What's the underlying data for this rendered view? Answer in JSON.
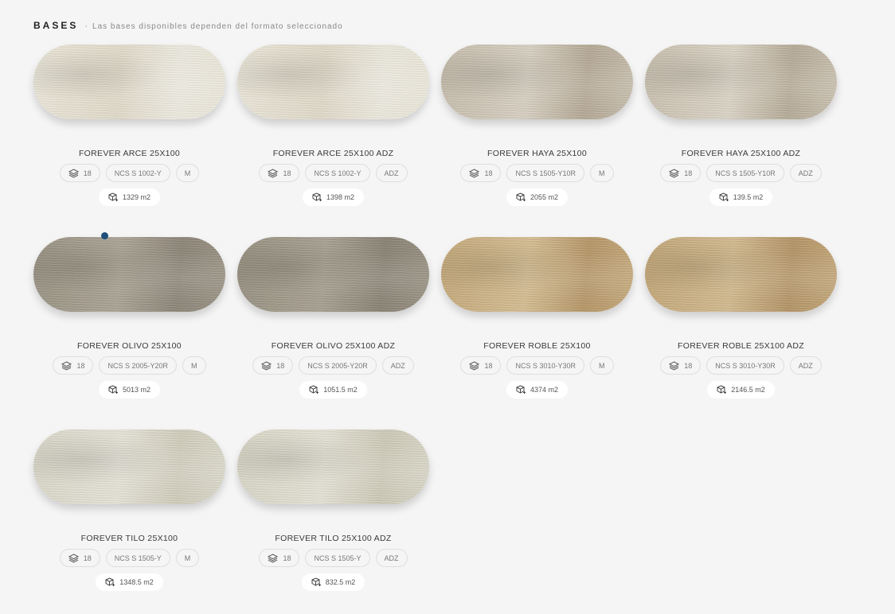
{
  "header": {
    "title": "BASES",
    "separator": "·",
    "subtitle": "Las bases disponibles dependen del formato seleccionado"
  },
  "items": [
    {
      "name": "FOREVER ARCE 25X100",
      "thickness": "18",
      "ncs": "NCS S 1002-Y",
      "finish": "M",
      "stock": "1329 m2",
      "tone": [
        "#ece8da",
        "#e3ddcc",
        "#efece2"
      ]
    },
    {
      "name": "FOREVER ARCE 25X100 ADZ",
      "thickness": "18",
      "ncs": "NCS S 1002-Y",
      "finish": "ADZ",
      "stock": "1398 m2",
      "tone": [
        "#ece8da",
        "#e2dccb",
        "#eeebe0"
      ]
    },
    {
      "name": "FOREVER HAYA 25X100",
      "thickness": "18",
      "ncs": "NCS S 1505-Y10R",
      "finish": "M",
      "stock": "2055 m2",
      "tone": [
        "#c8bfae",
        "#d9d2c4",
        "#b7ab98"
      ]
    },
    {
      "name": "FOREVER HAYA 25X100 ADZ",
      "thickness": "18",
      "ncs": "NCS S 1505-Y10R",
      "finish": "ADZ",
      "stock": "139.5 m2",
      "tone": [
        "#cbc2b1",
        "#ddd6c8",
        "#b8ad9a"
      ]
    },
    {
      "name": "FOREVER OLIVO 25X100",
      "thickness": "18",
      "ncs": "NCS S 2005-Y20R",
      "finish": "M",
      "stock": "5013 m2",
      "tone": [
        "#9c9586",
        "#ada697",
        "#8f877a"
      ]
    },
    {
      "name": "FOREVER OLIVO 25X100 ADZ",
      "thickness": "18",
      "ncs": "NCS S 2005-Y20R",
      "finish": "ADZ",
      "stock": "1051.5 m2",
      "tone": [
        "#9a9384",
        "#aaa394",
        "#8c8577"
      ]
    },
    {
      "name": "FOREVER ROBLE 25X100",
      "thickness": "18",
      "ncs": "NCS S 3010-Y30R",
      "finish": "M",
      "stock": "4374 m2",
      "tone": [
        "#c7ab7c",
        "#d6bf95",
        "#b8996a"
      ]
    },
    {
      "name": "FOREVER ROBLE 25X100 ADZ",
      "thickness": "18",
      "ncs": "NCS S 3010-Y30R",
      "finish": "ADZ",
      "stock": "2146.5 m2",
      "tone": [
        "#c5a97a",
        "#d4bc92",
        "#b69769"
      ]
    },
    {
      "name": "FOREVER TILO 25X100",
      "thickness": "18",
      "ncs": "NCS S 1505-Y",
      "finish": "M",
      "stock": "1348.5 m2",
      "tone": [
        "#dcdacb",
        "#e7e5d9",
        "#d2cfbe"
      ]
    },
    {
      "name": "FOREVER TILO 25X100 ADZ",
      "thickness": "18",
      "ncs": "NCS S 1505-Y",
      "finish": "ADZ",
      "stock": "832.5 m2",
      "tone": [
        "#dad8c8",
        "#e6e4d7",
        "#cfccba"
      ]
    }
  ],
  "colors": {
    "accent_dot": "#1f4f7a",
    "background": "#f5f5f5"
  }
}
